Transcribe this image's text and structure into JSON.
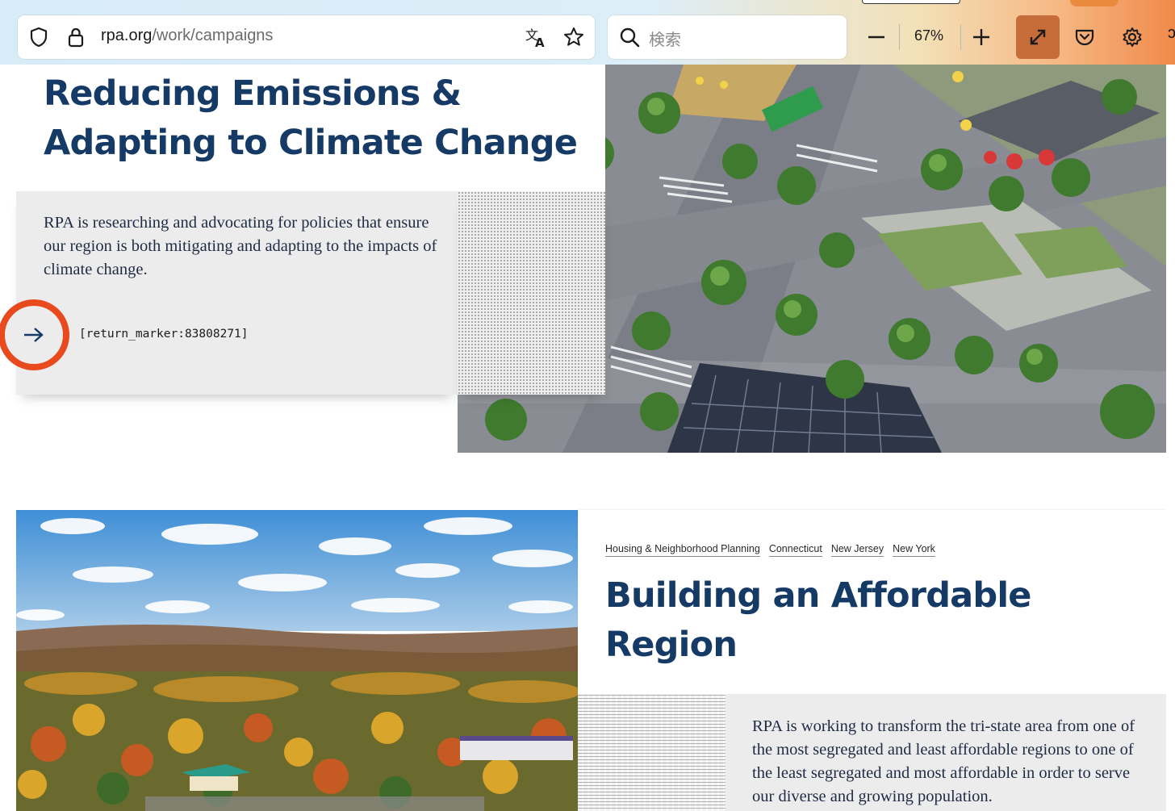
{
  "browser": {
    "url_host": "rpa.org",
    "url_path": "/work/campaigns",
    "search_placeholder": "検索",
    "zoom_level": "67%"
  },
  "campaigns": [
    {
      "title": "Reducing Emissions & Adapting to Climate Change",
      "description": "RPA is researching and advocating for policies that ensure our region is both mitigating and adapting to the impacts of climate change.",
      "link_text": "[return_marker:83808271]",
      "image": "aerial-street-redesign-render"
    },
    {
      "tags": [
        "Housing & Neighborhood Planning",
        "Connecticut",
        "New Jersey",
        "New York"
      ],
      "title": "Building an Affordable Region",
      "description": "RPA is working to transform the tri-state area from one of the most segregated and least affordable regions to one of the least segregated and most affordable in order to serve our diverse and growing population.",
      "image": "autumn-valley-photo"
    }
  ],
  "colors": {
    "title_navy": "#163a66",
    "accent_orange": "#e8491d",
    "panel_gray": "#ececec"
  }
}
